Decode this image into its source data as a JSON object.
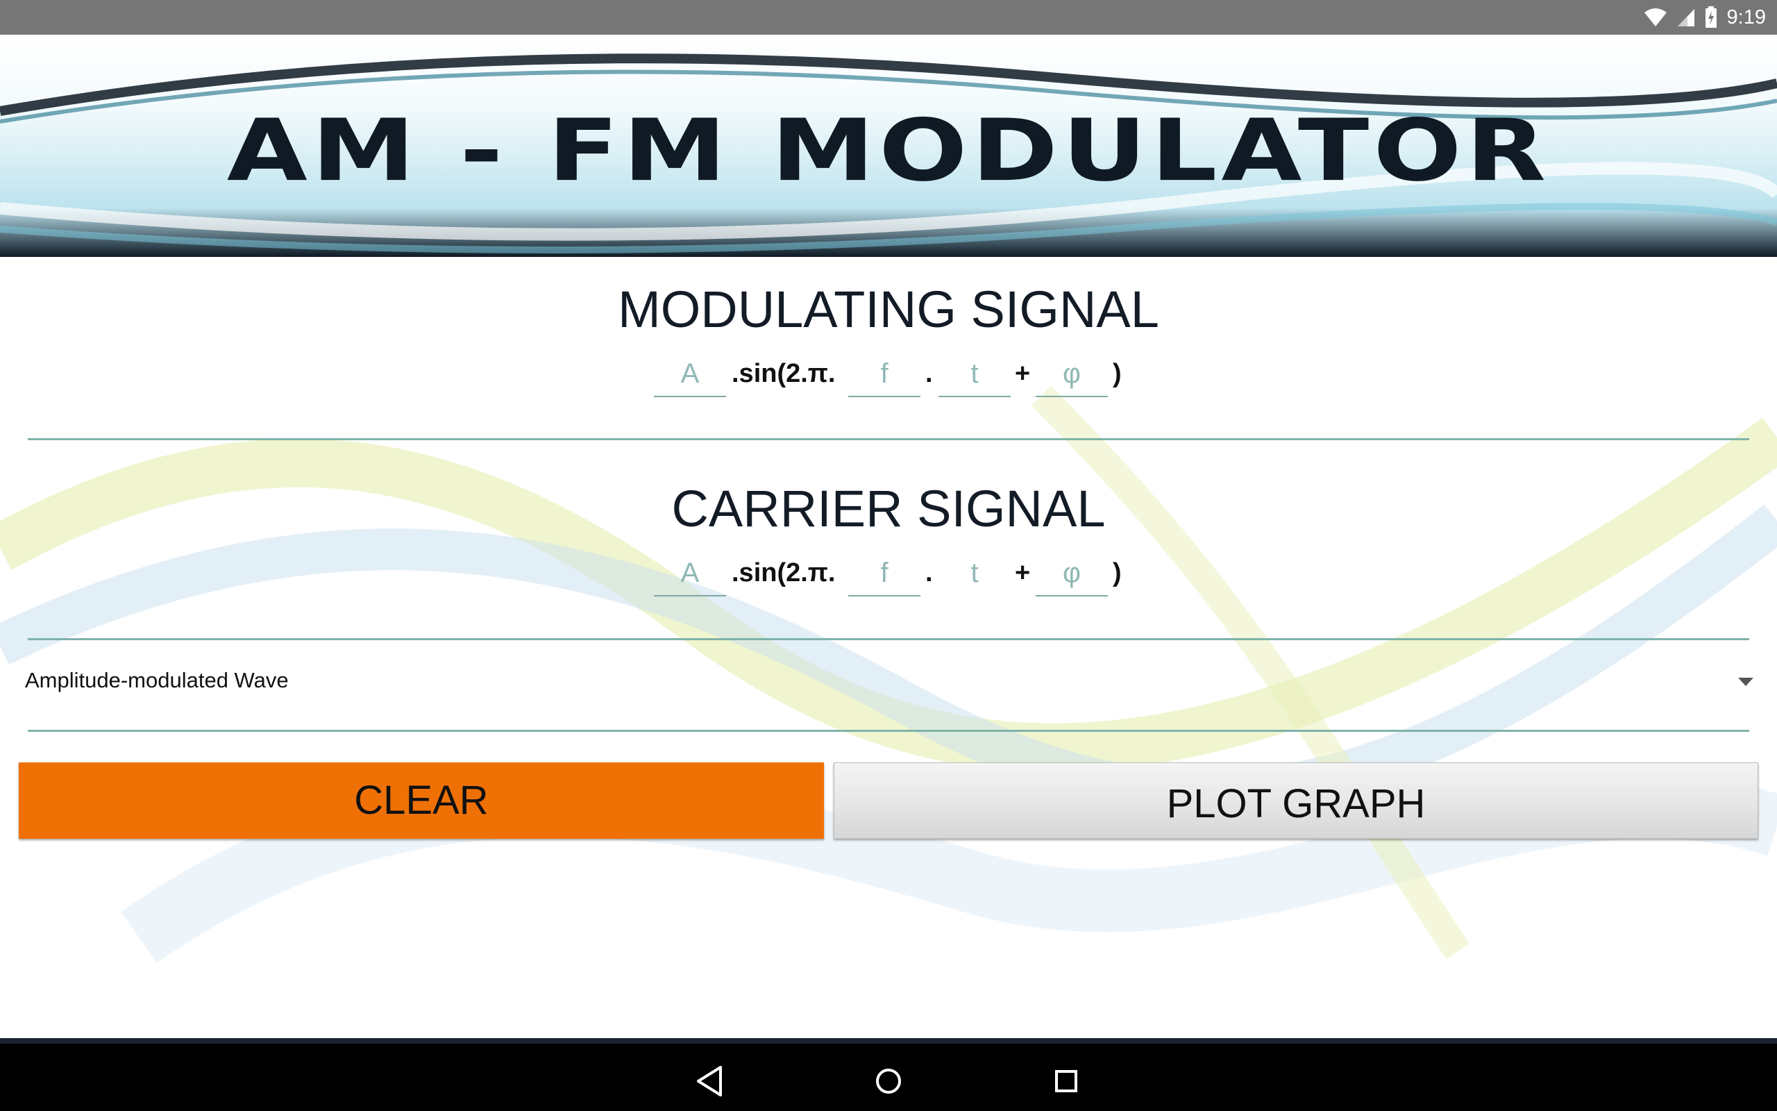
{
  "status_bar": {
    "time": "9:19",
    "icons": [
      "wifi-icon",
      "cell-signal-icon",
      "battery-charging-icon"
    ]
  },
  "banner": {
    "title": "AM - FM MODULATOR"
  },
  "modulating": {
    "title": "MODULATING SIGNAL",
    "amplitude_placeholder": "A",
    "sin_text": ".sin(2.π.",
    "frequency_placeholder": "f",
    "dot_text": ".",
    "time_placeholder": "t",
    "plus_text": "+",
    "phase_placeholder": "φ",
    "close_paren": ")"
  },
  "carrier": {
    "title": "CARRIER SIGNAL",
    "amplitude_placeholder": "A",
    "sin_text": ".sin(2.π.",
    "frequency_placeholder": "f",
    "dot_text": ".",
    "time_text": "t",
    "plus_text": "+",
    "phase_placeholder": "φ",
    "close_paren": ")"
  },
  "wave_type": {
    "selected": "Amplitude-modulated Wave"
  },
  "buttons": {
    "clear": "CLEAR",
    "plot": "PLOT GRAPH"
  },
  "nav_bar": {
    "icons": [
      "back-icon",
      "home-icon",
      "recents-icon"
    ]
  },
  "colors": {
    "clear_button": "#ef7106",
    "divider": "#7fb3a9",
    "placeholder": "#8fb8b4",
    "status_bar": "#767676"
  }
}
